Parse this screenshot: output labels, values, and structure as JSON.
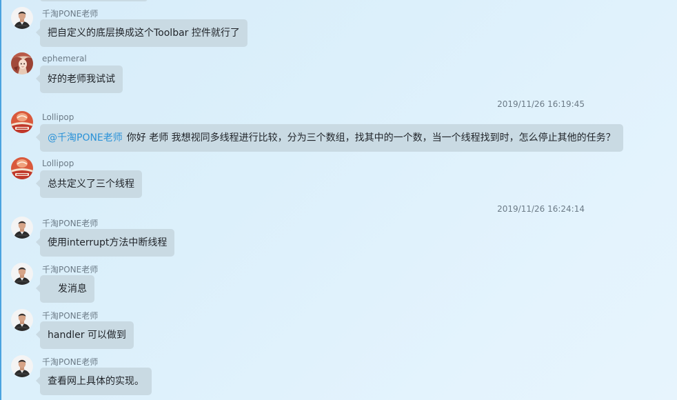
{
  "colors": {
    "bubble": "#c9dae3",
    "mention": "#2a92d8",
    "meta_text": "#6b7a86",
    "window_edge": "#4aa3df"
  },
  "messages": [
    {
      "sender": "千淘PONE老师",
      "avatar": "teacher-avatar",
      "text": "把自定义的底层换成这个Toolbar 控件就行了"
    },
    {
      "sender": "ephemeral",
      "avatar": "anime-girl-avatar",
      "text": "好的老师我试试"
    },
    {
      "timestamp": "2019/11/26 16:19:45"
    },
    {
      "sender": "Lollipop",
      "avatar": "lollipop-avatar",
      "mention": "@千淘PONE老师",
      "text": "你好 老师 我想视同多线程进行比较，分为三个数组，找其中的一个数，当一个线程找到时，怎么停止其他的任务？"
    },
    {
      "sender": "Lollipop",
      "avatar": "lollipop-avatar",
      "text": "总共定义了三个线程"
    },
    {
      "timestamp": "2019/11/26 16:24:14"
    },
    {
      "sender": "千淘PONE老师",
      "avatar": "teacher-avatar",
      "text": "使用interrupt方法中断线程"
    },
    {
      "sender": "千淘PONE老师",
      "avatar": "teacher-avatar",
      "text": "发消息"
    },
    {
      "sender": "千淘PONE老师",
      "avatar": "teacher-avatar",
      "text": "handler 可以做到"
    },
    {
      "sender": "千淘PONE老师",
      "avatar": "teacher-avatar",
      "text": "查看网上具体的实现。"
    }
  ]
}
